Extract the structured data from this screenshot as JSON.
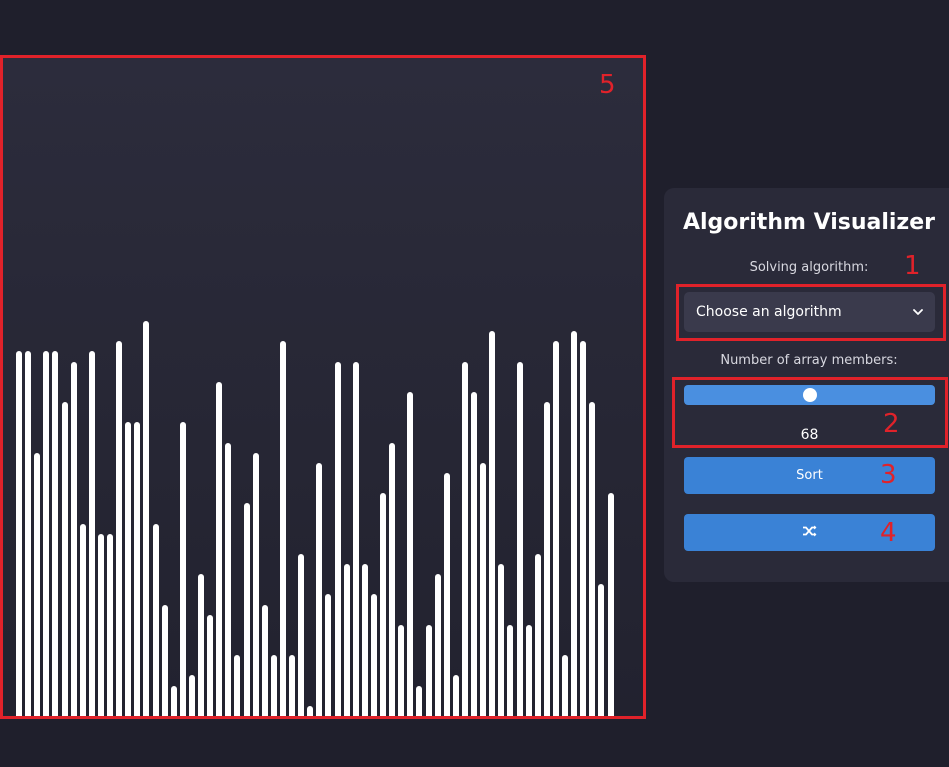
{
  "panel": {
    "title": "Algorithm Visualizer",
    "algorithm_label": "Solving algorithm:",
    "algorithm_select": {
      "selected": "Choose an algorithm",
      "icon": "chevron-down-icon"
    },
    "members_label": "Number of array members:",
    "members_slider": {
      "value": 68,
      "fraction": 0.5
    },
    "members_value": "68",
    "sort_button": "Sort",
    "shuffle_button_icon": "shuffle-icon"
  },
  "annotations": {
    "a1": "1",
    "a2": "2",
    "a3": "3",
    "a4": "4",
    "a5": "5"
  },
  "colors": {
    "background": "#1f1f2c",
    "panel": "#2a2a39",
    "accent": "#3a82d6",
    "slider": "#4a8fe0",
    "bar": "#ffffff",
    "annotation": "#e0222a"
  },
  "array": {
    "count": 68,
    "values": [
      36,
      36,
      26,
      36,
      36,
      31,
      35,
      19,
      36,
      18,
      18,
      37,
      29,
      29,
      39,
      19,
      11,
      3,
      29,
      4,
      14,
      10,
      33,
      27,
      6,
      21,
      26,
      11,
      6,
      37,
      6,
      16,
      1,
      25,
      12,
      35,
      15,
      35,
      15,
      12,
      22,
      27,
      9,
      32,
      3,
      9,
      14,
      24,
      4,
      35,
      32,
      25,
      38,
      15,
      9,
      35,
      9,
      16,
      31,
      37,
      6,
      38,
      37,
      31,
      13,
      22
    ]
  }
}
